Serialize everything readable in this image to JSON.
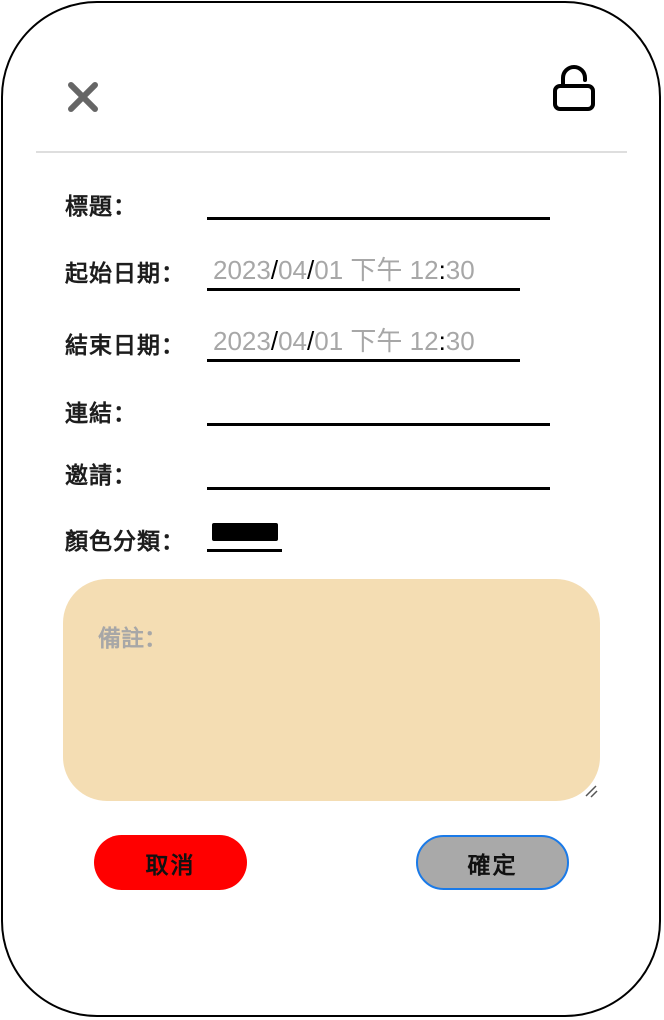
{
  "form": {
    "title_label": "標題：",
    "start_label": "起始日期：",
    "end_label": "結束日期：",
    "link_label": "連結：",
    "invite_label": "邀請：",
    "color_label": "顏色分類：",
    "title_value": "",
    "link_value": "",
    "invite_value": "",
    "color_value": "#000000"
  },
  "start_datetime": {
    "year": "2023",
    "month": "04",
    "day": "01",
    "ampm": "下午",
    "hour": "12",
    "minute": "30"
  },
  "end_datetime": {
    "year": "2023",
    "month": "04",
    "day": "01",
    "ampm": "下午",
    "hour": "12",
    "minute": "30"
  },
  "note": {
    "placeholder": "備註："
  },
  "buttons": {
    "cancel": "取消",
    "confirm": "確定"
  },
  "colors": {
    "note_bg": "#f4ddb3",
    "cancel_bg": "#ff0000",
    "confirm_bg": "#a9a9a9",
    "confirm_border": "#1a7ae8"
  },
  "icons": {
    "close": "close-icon",
    "lock": "unlock-icon",
    "resize": "resize-handle-icon"
  }
}
